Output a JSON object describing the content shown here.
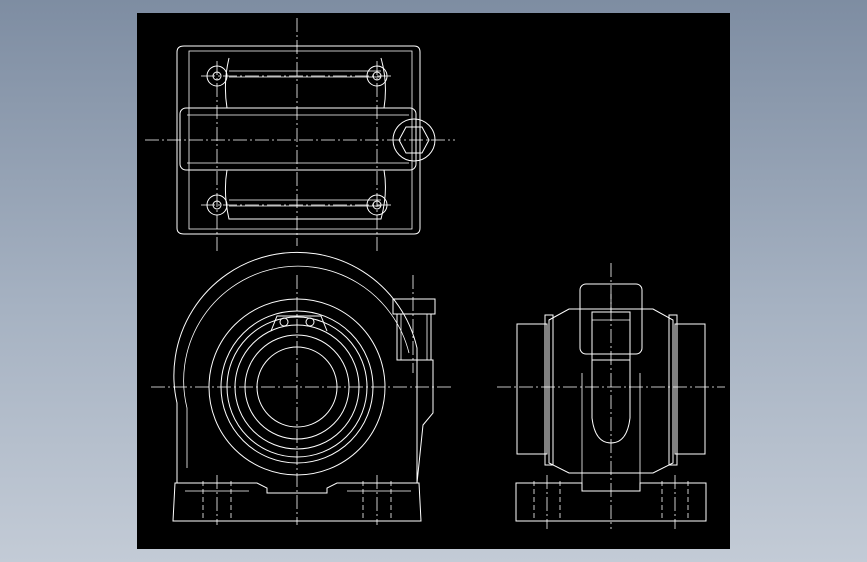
{
  "colors": {
    "background_top": "#7e8da2",
    "background_bottom": "#c3cbd6",
    "canvas": "#000000",
    "lines": "#ffffff"
  },
  "views": [
    "top-view",
    "front-view",
    "side-view"
  ]
}
